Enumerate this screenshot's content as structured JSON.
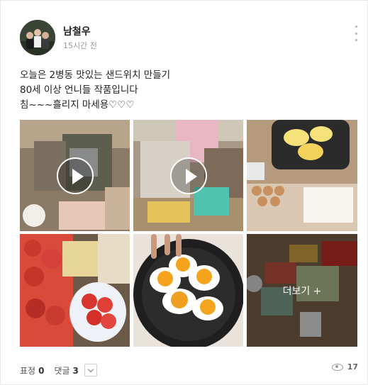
{
  "post": {
    "author": "남철우",
    "time": "15시간 전",
    "lines": [
      "오늘은 2병동 맛있는 샌드위치 만들기",
      "80세 이상 언니들 작품입니다",
      "침~~~흘리지 마세용♡♡♡"
    ]
  },
  "media": {
    "more_label": "더보기 +",
    "items": [
      {
        "kind": "video"
      },
      {
        "kind": "video"
      },
      {
        "kind": "photo"
      },
      {
        "kind": "photo"
      },
      {
        "kind": "photo"
      },
      {
        "kind": "photo-more"
      }
    ]
  },
  "footer": {
    "reaction_label": "표정",
    "reaction_count": "0",
    "comment_label": "댓글",
    "comment_count": "3",
    "view_count": "17"
  },
  "colors": {
    "text": "#222222",
    "muted": "#9a9a9a",
    "overlay": "rgba(0,0,0,0.45)"
  }
}
